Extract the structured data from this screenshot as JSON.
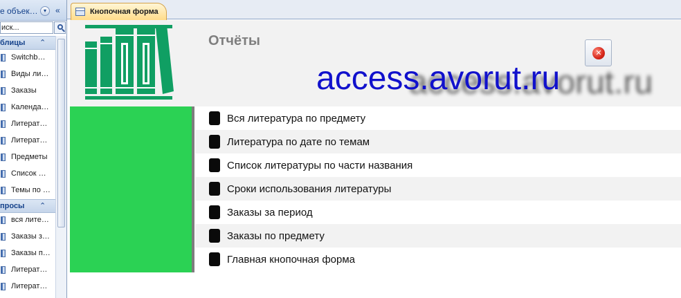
{
  "nav": {
    "title": "е объек…",
    "search_value": "иск...",
    "groups": [
      {
        "title": "блицы",
        "items": [
          "Switchb…",
          "Виды ли…",
          "Заказы",
          "Календа…",
          "Литерат…",
          "Литерат…",
          "Предметы",
          "Список …",
          "Темы по …"
        ]
      },
      {
        "title": "просы",
        "items": [
          "вся лите…",
          "Заказы з…",
          "Заказы п…",
          "Литерат…",
          "Литерат…"
        ]
      }
    ]
  },
  "tab": {
    "label": "Кнопочная форма"
  },
  "form": {
    "title": "Отчёты",
    "watermark": "access.avorut.ru",
    "watermark_shadow": "access.avorut.ru",
    "menu": [
      "Вся литература по предмету",
      "Литература по дате по темам",
      "Список литературы по части названия",
      "Сроки использования литературы",
      "Заказы за период",
      "Заказы по предмету",
      "Главная кнопочная форма"
    ]
  },
  "colors": {
    "logo_green": "#109f63",
    "panel_green": "#2bd254",
    "watermark_blue": "#1111cc",
    "title_gray": "#7f7f7f"
  },
  "icons": {
    "nav_dropdown": "chevron-down-icon",
    "nav_collapse": "double-chevron-left-icon",
    "search": "search-icon",
    "table": "table-icon",
    "query": "query-icon",
    "tab": "form-icon",
    "close": "close-icon"
  }
}
